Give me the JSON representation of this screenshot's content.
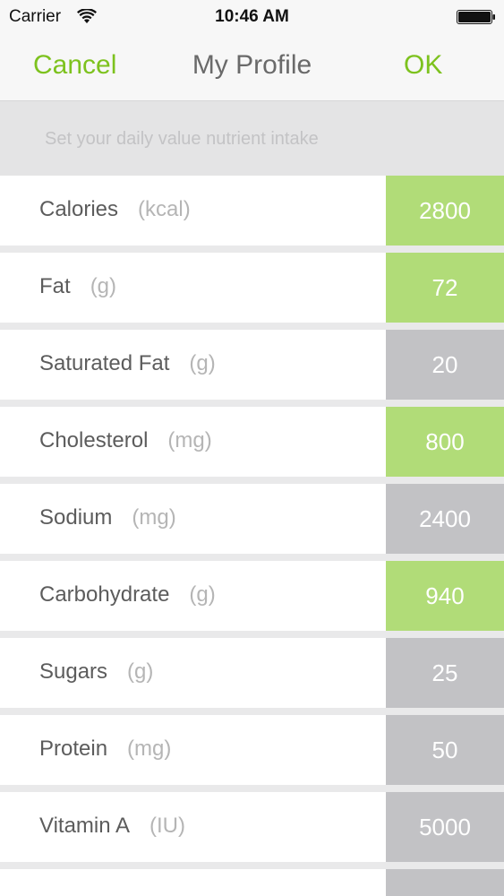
{
  "status_bar": {
    "carrier": "Carrier",
    "time": "10:46 AM",
    "wifi_icon": "wifi-icon",
    "battery_icon": "battery-full-icon"
  },
  "nav": {
    "cancel": "Cancel",
    "title": "My Profile",
    "ok": "OK"
  },
  "hint": "Set your daily value nutrient intake",
  "colors": {
    "accent_green": "#7dc21e",
    "value_green": "#b1dc78",
    "value_gray": "#c2c2c5"
  },
  "nutrients": [
    {
      "name": "Calories",
      "unit": "(kcal)",
      "value": "2800",
      "state": "green"
    },
    {
      "name": "Fat",
      "unit": "(g)",
      "value": "72",
      "state": "green"
    },
    {
      "name": "Saturated Fat",
      "unit": "(g)",
      "value": "20",
      "state": "gray"
    },
    {
      "name": "Cholesterol",
      "unit": "(mg)",
      "value": "800",
      "state": "green"
    },
    {
      "name": "Sodium",
      "unit": "(mg)",
      "value": "2400",
      "state": "gray"
    },
    {
      "name": "Carbohydrate",
      "unit": "(g)",
      "value": "940",
      "state": "green"
    },
    {
      "name": "Sugars",
      "unit": "(g)",
      "value": "25",
      "state": "gray"
    },
    {
      "name": "Protein",
      "unit": "(mg)",
      "value": "50",
      "state": "gray"
    },
    {
      "name": "Vitamin A",
      "unit": "(IU)",
      "value": "5000",
      "state": "gray"
    }
  ]
}
